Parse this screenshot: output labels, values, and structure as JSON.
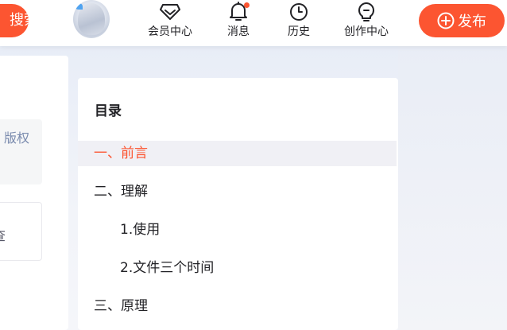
{
  "header": {
    "search_label": "搜索",
    "nav": [
      {
        "label": "会员中心",
        "icon": "diamond-icon"
      },
      {
        "label": "消息",
        "icon": "bell-icon"
      },
      {
        "label": "历史",
        "icon": "clock-icon"
      },
      {
        "label": "创作中心",
        "icon": "lightbulb-icon"
      }
    ],
    "publish_label": "发布",
    "accent_color": "#fc5531"
  },
  "sidebar_left": {
    "copyright_text": "版权",
    "box_text": "查"
  },
  "toc": {
    "title": "目录",
    "items": [
      {
        "label": "一、前言",
        "active": true
      },
      {
        "label": "二、理解",
        "active": false
      },
      {
        "label": "1.使用",
        "active": false
      },
      {
        "label": "2.文件三个时间",
        "active": false
      },
      {
        "label": "三、原理",
        "active": false
      }
    ]
  }
}
